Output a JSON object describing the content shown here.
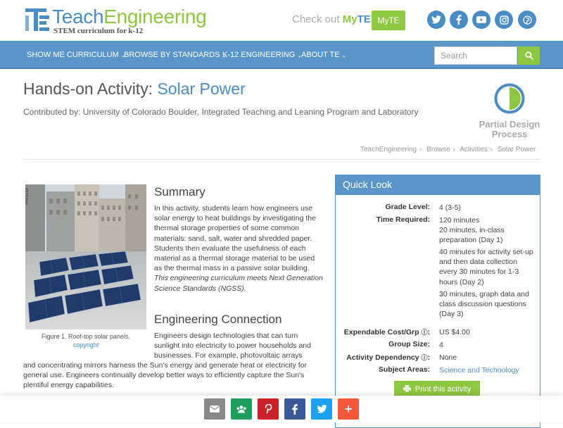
{
  "header": {
    "logo_title_part1": "Teach",
    "logo_title_part2": "Engineering",
    "logo_subtitle": "STEM curriculum for k-12",
    "checkout_prefix": "Check out ",
    "checkout_my": "My",
    "checkout_te": "TE",
    "myte_button": "MyTE",
    "social_icons": [
      "twitter-icon",
      "facebook-icon",
      "youtube-icon",
      "instagram-icon",
      "pinterest-icon"
    ]
  },
  "nav": {
    "items": [
      {
        "label": "SHOW ME CURRICULUM"
      },
      {
        "label": "BROWSE BY STANDARDS"
      },
      {
        "label": "K-12 ENGINEERING"
      },
      {
        "label": "ABOUT TE"
      }
    ],
    "search_placeholder": "Search"
  },
  "page": {
    "title_prefix": "Hands-on Activity: ",
    "title_topic": "Solar Power",
    "contributed": "Contributed by: University of Colorado Boulder, Integrated Teaching and Leaning Program and Laboratory",
    "design_label": "Partial Design Process",
    "breadcrumb": [
      "TeachEngineering",
      "Browse",
      "Activities",
      "Solar Power"
    ]
  },
  "figure": {
    "tag": "PIX1518",
    "caption": "Figure 1. Roof-top solar panels.",
    "copyright": "copyright"
  },
  "summary": {
    "heading": "Summary",
    "text": "In this activity, students learn how engineers use solar energy to heat buildings by investigating the thermal storage properties of some common materials: sand, salt, water and shredded paper. Students then evaluate the usefulness of each material as a thermal storage material to be used as the thermal mass in a passive solar building.",
    "ngss": "This engineering curriculum meets Next Generation Science Standards (NGSS)."
  },
  "engineering": {
    "heading": "Engineering Connection",
    "text_part1": "Engineers design technologies that can turn sunlight into electricity to power households and businesses. For example, photovoltaic arrays",
    "text_part2": "and concentrating mirrors harness the Sun's energy and generate heat or electricity for general use. Engineers continually develop better ways to efficiently capture the Sun's plentiful energy capabilities."
  },
  "quick_look": {
    "heading": "Quick Look",
    "grade_label": "Grade Level:",
    "grade_value": "4 (3-5)",
    "time_label": "Time Required:",
    "time_values": [
      "120 minutes",
      "20 minutes, in-class preparation (Day 1)",
      "40 minutes for activity set-up and then data collection every 30 minutes for 1-3 hours (Day 2)",
      "30 minutes, graph data and class discussion questions (Day 3)"
    ],
    "cost_label": "Expendable Cost/Grp",
    "cost_value": "US $4.00",
    "group_label": "Group Size:",
    "group_value": "4",
    "dependency_label": "Activity Dependency",
    "dependency_value": "None",
    "subject_label": "Subject Areas:",
    "subject_value": "Science and Technology",
    "print_button": "Print this activity"
  },
  "share": {
    "buttons": [
      {
        "name": "email-share-icon",
        "color": "#888888"
      },
      {
        "name": "google-classroom-share-icon",
        "color": "#1e9e5a"
      },
      {
        "name": "pinterest-share-icon",
        "color": "#cb2027"
      },
      {
        "name": "facebook-share-icon",
        "color": "#3b5998"
      },
      {
        "name": "twitter-share-icon",
        "color": "#1da1f2"
      },
      {
        "name": "more-share-icon",
        "color": "#f5573b"
      }
    ]
  },
  "colors": {
    "brand_blue": "#4a8cc4",
    "brand_green": "#8dc63f",
    "nav_blue": "#5a95c9"
  }
}
